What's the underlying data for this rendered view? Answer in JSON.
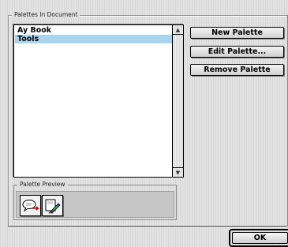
{
  "palettes_group": {
    "legend": "Palettes In Document",
    "list_items": [
      {
        "label": "Ay Book",
        "selected": false
      },
      {
        "label": "Tools",
        "selected": true
      }
    ]
  },
  "buttons": {
    "new_palette": "New Palette",
    "edit_palette": "Edit Palette...",
    "remove_palette": "Remove Palette"
  },
  "preview_group": {
    "legend": "Palette Preview",
    "tools": [
      {
        "icon": "speech-bubble-arrow-icon"
      },
      {
        "icon": "pencil-eraser-icon"
      }
    ]
  },
  "dialog": {
    "ok_label": "OK"
  },
  "colors": {
    "selection": "#a8d4ee"
  }
}
